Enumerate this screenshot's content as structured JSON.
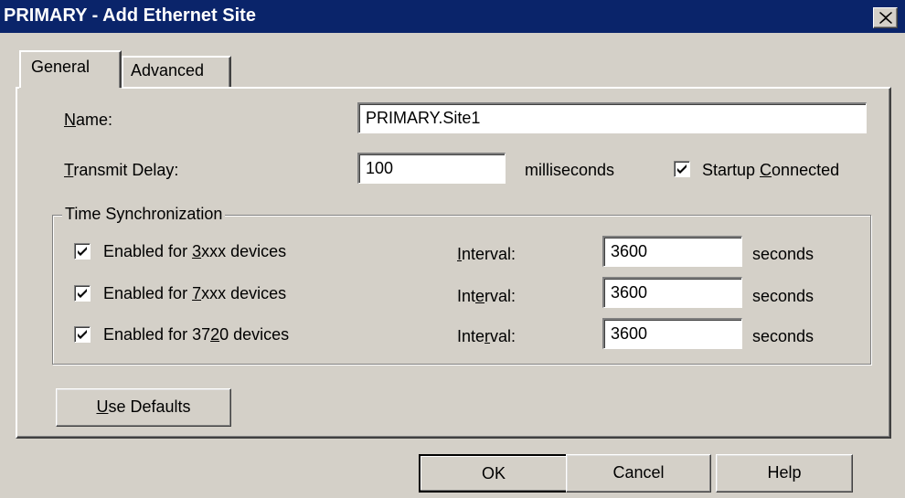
{
  "window": {
    "title": "PRIMARY - Add Ethernet Site",
    "close_icon": "close-icon"
  },
  "tabs": [
    {
      "label": "General",
      "active": true
    },
    {
      "label": "Advanced",
      "active": false
    }
  ],
  "form": {
    "name": {
      "prefix": "N",
      "rest": "ame:",
      "value": "PRIMARY.Site1"
    },
    "transmit_delay": {
      "prefix": "T",
      "rest": "ransmit Delay:",
      "value": "100",
      "unit": "milliseconds"
    },
    "startup_connected": {
      "before": "Startup ",
      "mnemonic": "C",
      "after": "onnected",
      "checked": true
    }
  },
  "time_sync": {
    "legend": "Time Synchronization",
    "rows": [
      {
        "label_before": "Enabled for ",
        "label_mnemonic": "3",
        "label_after": "xxx devices",
        "interval_before": "",
        "interval_mnemonic": "I",
        "interval_after": "nterval:",
        "value": "3600",
        "unit": "seconds",
        "checked": true
      },
      {
        "label_before": "Enabled for ",
        "label_mnemonic": "7",
        "label_after": "xxx devices",
        "interval_before": "Int",
        "interval_mnemonic": "e",
        "interval_after": "rval:",
        "value": "3600",
        "unit": "seconds",
        "checked": true
      },
      {
        "label_before": "Enabled for 37",
        "label_mnemonic": "2",
        "label_after": "0 devices",
        "interval_before": "Inte",
        "interval_mnemonic": "r",
        "interval_after": "val:",
        "value": "3600",
        "unit": "seconds",
        "checked": true
      }
    ]
  },
  "use_defaults": {
    "mnemonic": "U",
    "rest": "se Defaults"
  },
  "buttons": {
    "ok": "OK",
    "cancel": "Cancel",
    "help": "Help"
  }
}
